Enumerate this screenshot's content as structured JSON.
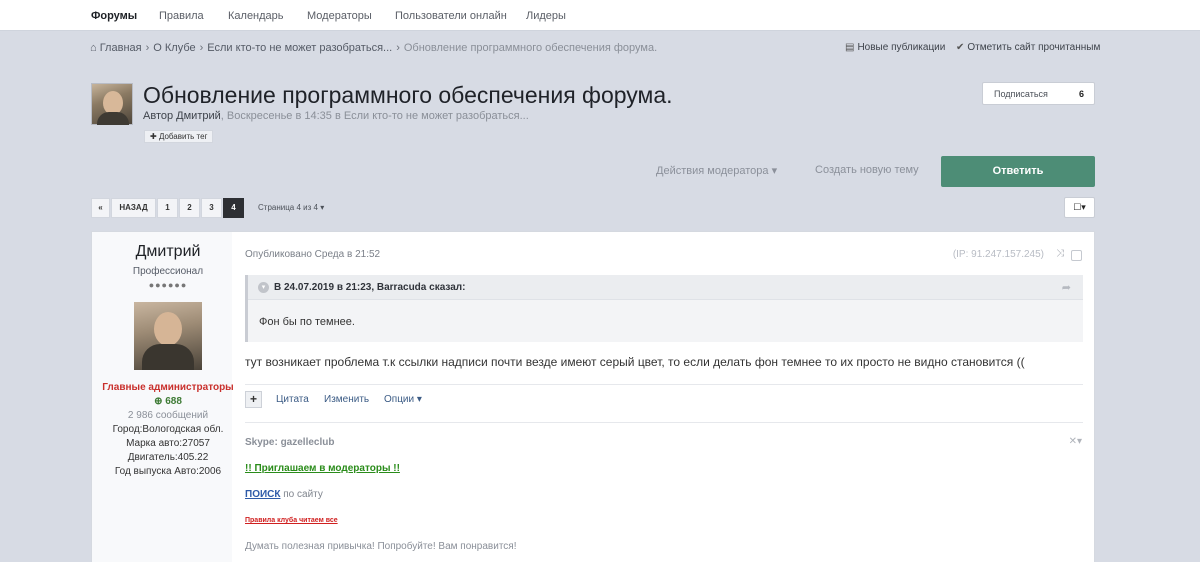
{
  "nav": {
    "items": [
      {
        "label": "Форумы",
        "active": true
      },
      {
        "label": "Правила"
      },
      {
        "label": "Календарь"
      },
      {
        "label": "Модераторы"
      },
      {
        "label": "Пользователи онлайн"
      },
      {
        "label": "Лидеры"
      }
    ]
  },
  "breadcrumb": {
    "home": "Главная",
    "club": "О Клубе",
    "forum": "Если кто-то не может разобраться...",
    "current": "Обновление программного обеспечения форума.",
    "new_posts": "Новые публикации",
    "mark_read": "Отметить сайт прочитанным"
  },
  "topic": {
    "title": "Обновление программного обеспечения форума.",
    "author_prefix": "Автор",
    "author": "Дмитрий",
    "meta_rest": ", Воскресенье в 14:35 в Если кто-то не может разобраться...",
    "add_tag": "Добавить тег",
    "follow_label": "Подписаться",
    "follow_count": "6",
    "mod_actions": "Действия модератора",
    "new_topic": "Создать новую тему",
    "reply": "Ответить"
  },
  "pagination": {
    "back": "НАЗАД",
    "pages": [
      "1",
      "2",
      "3",
      "4"
    ],
    "current": "4",
    "info": "Страница 4 из 4"
  },
  "post": {
    "author": {
      "name": "Дмитрий",
      "rank": "Профессионал",
      "pips": "●●●●●●",
      "group": "Главные администраторы",
      "reputation": "688",
      "posts": "2 986 сообщений",
      "fields": [
        "Город:Вологодская обл.",
        "Марка авто:27057",
        "Двигатель:405.22",
        "Год выпуска Авто:2006"
      ]
    },
    "published": "Опубликовано Среда в 21:52",
    "ip": "(IP: 91.247.157.245)",
    "quote": {
      "header": "В 24.07.2019 в 21:23, Barracuda сказал:",
      "text": "Фон бы по темнее."
    },
    "text": "тут возникает проблема т.к ссылки надписи почти везде имеют серый цвет, то если делать фон темнее то их просто не видно становится ((",
    "actions": {
      "quote": "Цитата",
      "edit": "Изменить",
      "options": "Опции"
    },
    "signature": {
      "skype": "Skype: gazelleclub",
      "invite": "!! Приглашаем в модераторы !!",
      "search_link": "ПОИСК",
      "search_rest": "по сайту",
      "rules": "Правила клуба читаем все",
      "motto": "Думать полезная привычка! Попробуйте! Вам понравится!"
    }
  },
  "colors": {
    "accent": "#4d8d76",
    "background": "#d7dbe4",
    "admin_group": "#c9302c",
    "reputation": "#3d7a34"
  }
}
